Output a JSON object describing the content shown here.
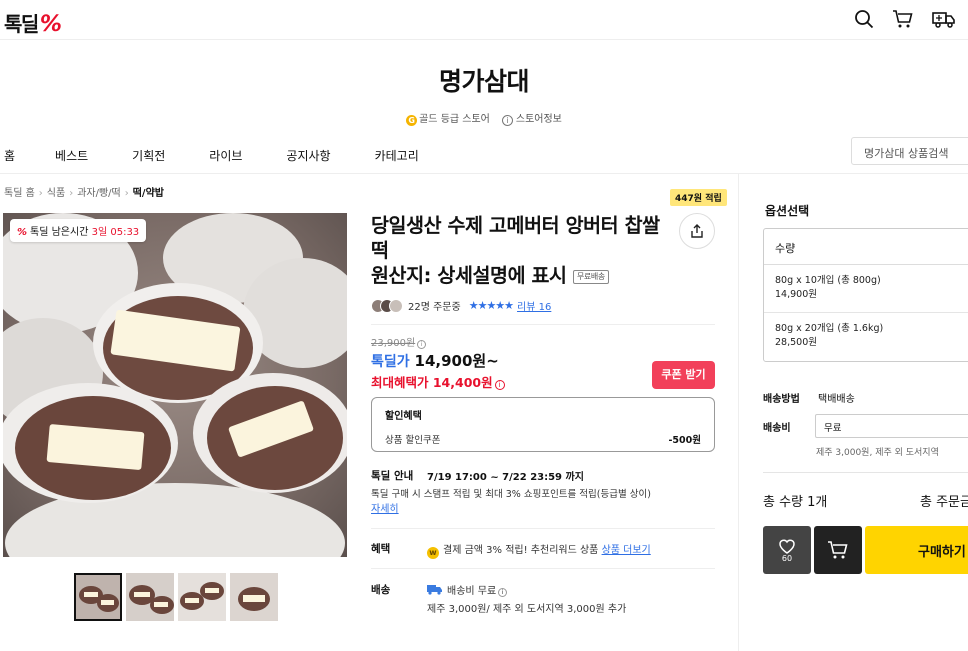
{
  "header": {
    "logo_text": "톡딜",
    "logo_mark": "%",
    "icons": [
      "search-icon",
      "cart-icon",
      "delivery-truck-icon"
    ]
  },
  "store": {
    "name": "명가삼대",
    "grade_badge": "G",
    "grade": "골드 등급 스토어",
    "info_icon": "i",
    "info": "스토어정보"
  },
  "nav": {
    "items": [
      "홈",
      "베스트",
      "기획전",
      "라이브",
      "공지사항",
      "카테고리"
    ],
    "search_placeholder": "명가삼대 상품검색"
  },
  "breadcrumb": [
    "톡딜 홈",
    "식품",
    "과자/빵/떡",
    "떡/약밥"
  ],
  "timer": {
    "label": "톡딜 남은시간",
    "time": "3일 05:33"
  },
  "product": {
    "points_badge": "447원 적립",
    "title_line1": "당일생산 수제 고메버터 앙버터 찹쌀떡",
    "title_line2": "원산지: 상세설명에 표시",
    "free_tag": "무료배송",
    "orders": "22명 주문중",
    "stars": "★★★★★",
    "review": "리뷰 16",
    "original_price": "23,900원",
    "sale_label": "톡딜가",
    "sale_price": "14,900원~",
    "max_benefit": "최대혜택가 14,400원",
    "coupon_button": "쿠폰 받기"
  },
  "discount": {
    "title": "할인혜택",
    "item": "상품 할인쿠폰",
    "amount": "-500원"
  },
  "info_rows": {
    "talk_label": "톡딜 안내",
    "talk_period": "7/19 17:00 ~ 7/22 23:59 까지",
    "talk_desc": "톡딜 구매 시 스탬프 적립 및 최대 3% 쇼핑포인트를 적립(등급별 상이)",
    "detail_link": "자세히",
    "benefit_label": "혜택",
    "benefit_coin": "w",
    "benefit_text": "결제 금액 3% 적립! 추천리워드 상품",
    "benefit_link": "상품 더보기",
    "delivery_label": "배송",
    "delivery_fee": "배송비 무료",
    "delivery_note": "제주 3,000원/ 제주 외 도서지역 3,000원 추가"
  },
  "options": {
    "title": "옵션선택",
    "head": "수량",
    "items": [
      {
        "name": "80g x 10개입 (총 800g)",
        "price": "14,900원"
      },
      {
        "name": "80g x 20개입 (총 1.6kg)",
        "price": "28,500원"
      }
    ],
    "ship_method_label": "배송방법",
    "ship_method": "택배배송",
    "ship_fee_label": "배송비",
    "ship_fee": "무료",
    "ship_note": "제주 3,000원, 제주 외 도서지역",
    "total_qty": "총 수량 1개",
    "total_price": "총 주문금",
    "wish_count": "60",
    "buy_button": "구매하기"
  }
}
